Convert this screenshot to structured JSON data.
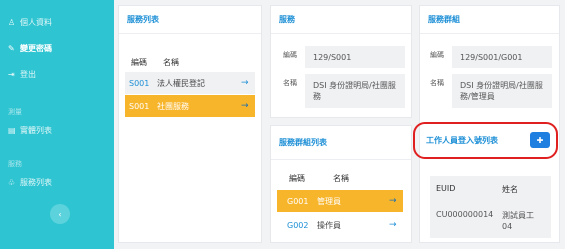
{
  "sidebar": {
    "items": [
      {
        "icon": "user-icon",
        "glyph": "♙",
        "label": "個人資料"
      },
      {
        "icon": "key-icon",
        "glyph": "✎",
        "label": "變更密碼"
      },
      {
        "icon": "logout-icon",
        "glyph": "⇥",
        "label": "登出"
      }
    ],
    "section1": "測量",
    "item_list": {
      "icon": "list-icon",
      "glyph": "▤",
      "label": "實體列表"
    },
    "section2": "服務",
    "item_service": {
      "icon": "group-icon",
      "glyph": "♧",
      "label": "服務列表"
    },
    "collapse_glyph": "‹"
  },
  "service_list": {
    "title": "服務列表",
    "col_code": "編碼",
    "col_name": "名稱",
    "rows": [
      {
        "code": "S001",
        "name": "法人權民登記",
        "arrow": "→"
      },
      {
        "code": "S001",
        "name": "社團服務",
        "arrow": "→"
      }
    ]
  },
  "service": {
    "title": "服務",
    "code_label": "編碼",
    "code_value": "129/S001",
    "name_label": "名稱",
    "name_value": "DSI 身份證明局/社團服務"
  },
  "group_list": {
    "title": "服務群組列表",
    "col_code": "編碼",
    "col_name": "名稱",
    "rows": [
      {
        "code": "G001",
        "name": "管理員",
        "arrow": "→"
      },
      {
        "code": "G002",
        "name": "操作員",
        "arrow": "→"
      }
    ]
  },
  "group": {
    "title": "服務群組",
    "code_label": "編碼",
    "code_value": "129/S001/G001",
    "name_label": "名稱",
    "name_value": "DSI 身份證明局/社團服務/管理員"
  },
  "staff": {
    "title": "工作人員登入號列表",
    "add_icon": "add-user-icon",
    "add_glyph": "✚",
    "col_euid": "EUID",
    "col_name": "姓名",
    "euid": "CU000000014",
    "name": "測試員工04"
  }
}
